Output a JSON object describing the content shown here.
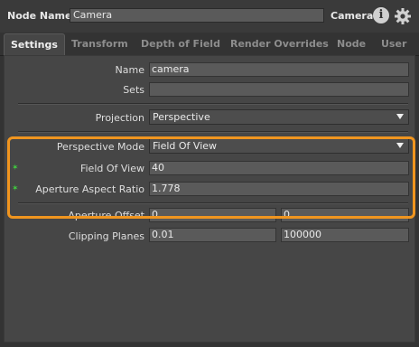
{
  "header": {
    "node_name_label": "Node Name",
    "node_name_value": "Camera",
    "node_type": "Camera",
    "info_icon": "info-icon",
    "gear_icon": "gear-icon"
  },
  "tabs": [
    {
      "label": "Settings",
      "active": true
    },
    {
      "label": "Transform",
      "active": false
    },
    {
      "label": "Depth of Field",
      "active": false
    },
    {
      "label": "Render Overrides",
      "active": false
    },
    {
      "label": "Node",
      "active": false
    },
    {
      "label": "User",
      "active": false
    }
  ],
  "fields": {
    "name": {
      "label": "Name",
      "value": "camera"
    },
    "sets": {
      "label": "Sets",
      "value": ""
    },
    "projection": {
      "label": "Projection",
      "value": "Perspective"
    },
    "perspective_mode": {
      "label": "Perspective Mode",
      "value": "Field Of View"
    },
    "field_of_view": {
      "label": "Field Of View",
      "value": "40"
    },
    "aperture_aspect_ratio": {
      "label": "Aperture Aspect Ratio",
      "value": "1.778"
    },
    "aperture_offset": {
      "label": "Aperture Offset",
      "values": [
        "0",
        "0"
      ]
    },
    "clipping_planes": {
      "label": "Clipping Planes",
      "values": [
        "0.01",
        "100000"
      ]
    }
  },
  "colors": {
    "highlight": "#f0951f",
    "modified_marker": "#3fcf3f"
  }
}
